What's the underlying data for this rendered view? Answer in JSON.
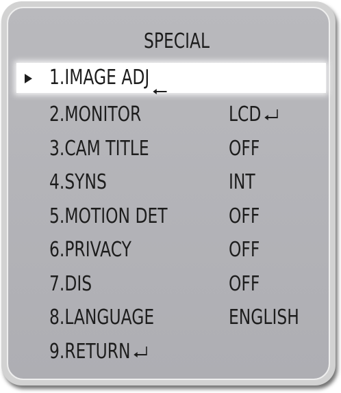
{
  "menu": {
    "title": "SPECIAL",
    "selected_index": 0,
    "items": [
      {
        "label": "1.IMAGE ADJ",
        "value": "",
        "icon": "left-arrow-icon"
      },
      {
        "label": "2.MONITOR",
        "value": "LCD",
        "icon": "enter-icon"
      },
      {
        "label": "3.CAM TITLE",
        "value": "OFF"
      },
      {
        "label": "4.SYNS",
        "value": "INT"
      },
      {
        "label": "5.MOTION DET",
        "value": "OFF"
      },
      {
        "label": "6.PRIVACY",
        "value": "OFF"
      },
      {
        "label": "7.DIS",
        "value": "OFF"
      },
      {
        "label": "8.LANGUAGE",
        "value": "ENGLISH"
      },
      {
        "label": "9.RETURN",
        "value": "",
        "icon": "enter-icon"
      }
    ]
  },
  "colors": {
    "panel": "#b9b9bd",
    "highlight": "#ffffff",
    "text": "#1d1d1d"
  }
}
